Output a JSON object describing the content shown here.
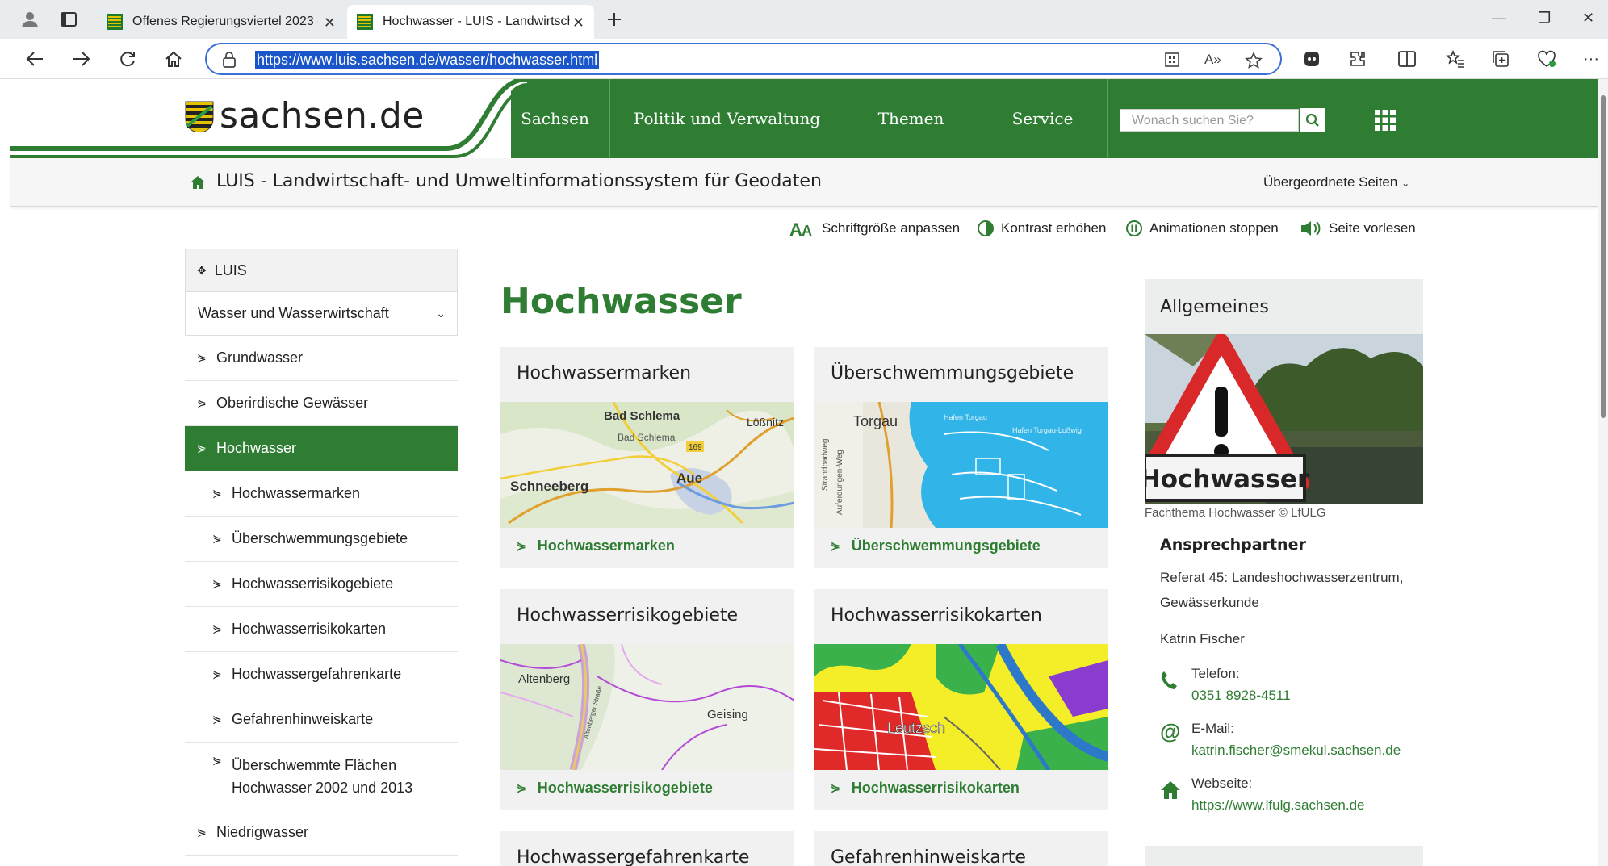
{
  "browser": {
    "tabs": [
      {
        "title": "Offenes Regierungsviertel 2023 -",
        "active": false
      },
      {
        "title": "Hochwasser - LUIS - Landwirtsch",
        "active": true
      }
    ],
    "url": "https://www.luis.sachsen.de/wasser/hochwasser.html"
  },
  "site": {
    "logo_text": "sachsen.de",
    "nav": [
      "Sachsen",
      "Politik und Verwaltung",
      "Themen",
      "Service"
    ],
    "search_placeholder": "Wonach suchen Sie?",
    "subtitle": "LUIS - Landwirtschaft- und Umweltinformationssystem für Geodaten",
    "parent_pages": "Übergeordnete Seiten",
    "a11y": [
      "Schriftgröße anpassen",
      "Kontrast erhöhen",
      "Animationen stoppen",
      "Seite vorlesen"
    ],
    "brand_color": "#2e7d32"
  },
  "sidebar": {
    "root": "LUIS",
    "section": "Wasser und Wasserwirtschaft",
    "items": [
      {
        "label": "Grundwasser",
        "level": 1,
        "active": false
      },
      {
        "label": "Oberirdische Gewässer",
        "level": 1,
        "active": false
      },
      {
        "label": "Hochwasser",
        "level": 1,
        "active": true
      },
      {
        "label": "Hochwassermarken",
        "level": 2,
        "active": false
      },
      {
        "label": "Überschwemmungsgebiete",
        "level": 2,
        "active": false
      },
      {
        "label": "Hochwasserrisikogebiete",
        "level": 2,
        "active": false
      },
      {
        "label": "Hochwasserrisikokarten",
        "level": 2,
        "active": false
      },
      {
        "label": "Hochwassergefahrenkarte",
        "level": 2,
        "active": false
      },
      {
        "label": "Gefahrenhinweiskarte",
        "level": 2,
        "active": false
      },
      {
        "label": "Überschwemmte Flächen Hochwasser 2002 und 2013",
        "level": 2,
        "active": false
      },
      {
        "label": "Niedrigwasser",
        "level": 1,
        "active": false
      }
    ]
  },
  "main": {
    "heading": "Hochwasser",
    "cards": [
      {
        "title": "Hochwassermarken",
        "link": "Hochwassermarken",
        "map_labels": [
          "Bad Schlema",
          "Bad Schlema",
          "Lößnitz",
          "Schneeberg",
          "Aue",
          "169"
        ]
      },
      {
        "title": "Überschwemmungsgebiete",
        "link": "Überschwemmungsgebiete",
        "map_labels": [
          "Torgau",
          "Hafen Torgau",
          "Hafen Torgau-Loßwig",
          "Strandbadweg",
          "Auferdungen-Weg"
        ]
      },
      {
        "title": "Hochwasserrisikogebiete",
        "link": "Hochwasserrisikogebiete",
        "map_labels": [
          "Altenberg",
          "Geising",
          "Altenberger Straße"
        ]
      },
      {
        "title": "Hochwasserrisikokarten",
        "link": "Hochwasserrisikokarten",
        "map_labels": [
          "Leutzsch"
        ]
      },
      {
        "title": "Hochwassergefahrenkarte",
        "link": ""
      },
      {
        "title": "Gefahrenhinweiskarte",
        "link": ""
      }
    ]
  },
  "aside": {
    "heading": "Allgemeines",
    "image_sign_text": "Hochwasser",
    "caption": "Fachthema Hochwasser © LfULG",
    "contact_title": "Ansprechpartner",
    "org_line1": "Referat 45: Landeshochwasserzentrum,",
    "org_line2": "Gewässerkunde",
    "person": "Katrin Fischer",
    "phone_label": "Telefon:",
    "phone": "0351 8928-4511",
    "email_label": "E-Mail:",
    "email": "katrin.fischer@smekul.sachsen.de",
    "web_label": "Webseite:",
    "web": "https://www.lfulg.sachsen.de"
  }
}
